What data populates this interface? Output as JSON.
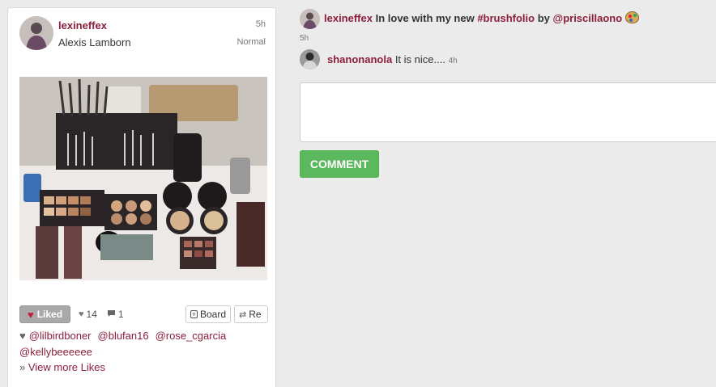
{
  "post": {
    "username": "lexineffex",
    "full_name": "Alexis Lamborn",
    "time": "5h",
    "status": "Normal",
    "liked_label": "Liked",
    "likes_count": "14",
    "comments_count": "1",
    "board_label": "Board",
    "repin_label": "Re",
    "likers": [
      "@lilbirdboner",
      "@blufan16",
      "@rose_cgarcia",
      "@kellybeeeeee"
    ],
    "view_more": "View more Likes",
    "view_more_prefix": "»"
  },
  "caption": {
    "username": "lexineffex",
    "text_before": "In love with my new",
    "hashtag": "#brushfolio",
    "text_by": "by",
    "mention": "@priscillaono",
    "time": "5h"
  },
  "comment": {
    "username": "shanonanola",
    "text": "It is nice....",
    "time": "4h"
  },
  "comment_button": "COMMENT",
  "colors": {
    "brand": "#8d1f3b",
    "button_green": "#5cb85c",
    "background": "#ebebeb"
  }
}
